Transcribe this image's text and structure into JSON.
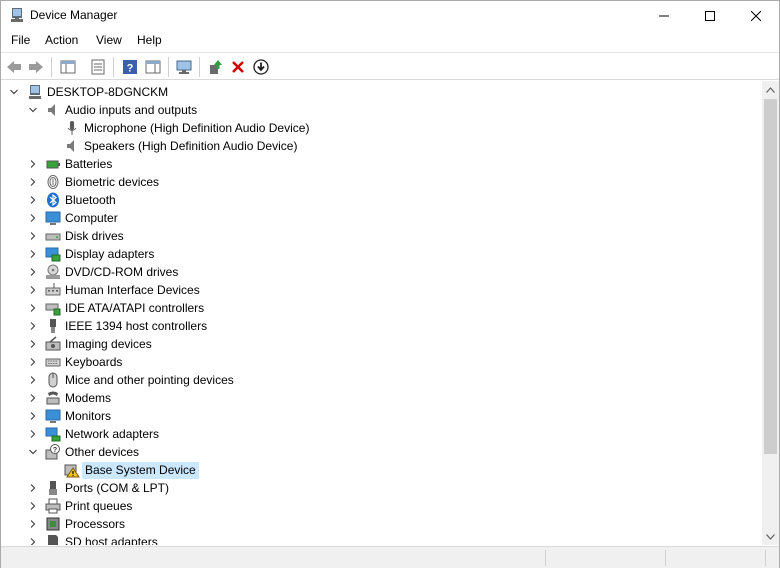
{
  "window": {
    "title": "Device Manager"
  },
  "menu": [
    "File",
    "Action",
    "View",
    "Help"
  ],
  "toolbar_icons": [
    "back-arrow-icon",
    "forward-arrow-icon",
    "show-hide-tree-icon",
    "properties-icon",
    "help-icon",
    "action-pane-icon",
    "scan-hardware-icon",
    "update-driver-icon",
    "uninstall-device-icon",
    "disable-device-icon"
  ],
  "tree": {
    "root": "DESKTOP-8DGNCKM",
    "audio": {
      "label": "Audio inputs and outputs",
      "children": [
        "Microphone (High Definition Audio Device)",
        "Speakers (High Definition Audio Device)"
      ]
    },
    "categories_a": [
      "Batteries",
      "Biometric devices",
      "Bluetooth",
      "Computer",
      "Disk drives",
      "Display adapters",
      "DVD/CD-ROM drives",
      "Human Interface Devices",
      "IDE ATA/ATAPI controllers",
      "IEEE 1394 host controllers",
      "Imaging devices",
      "Keyboards",
      "Mice and other pointing devices",
      "Modems",
      "Monitors",
      "Network adapters"
    ],
    "other": {
      "label": "Other devices",
      "children": [
        "Base System Device"
      ]
    },
    "categories_b": [
      "Ports (COM & LPT)",
      "Print queues",
      "Processors",
      "SD host adapters"
    ]
  },
  "colors": {
    "selection": "#cce8ff",
    "warning": "#f5c518",
    "accent": "#2f7dc8",
    "uninstall": "#d40000"
  }
}
